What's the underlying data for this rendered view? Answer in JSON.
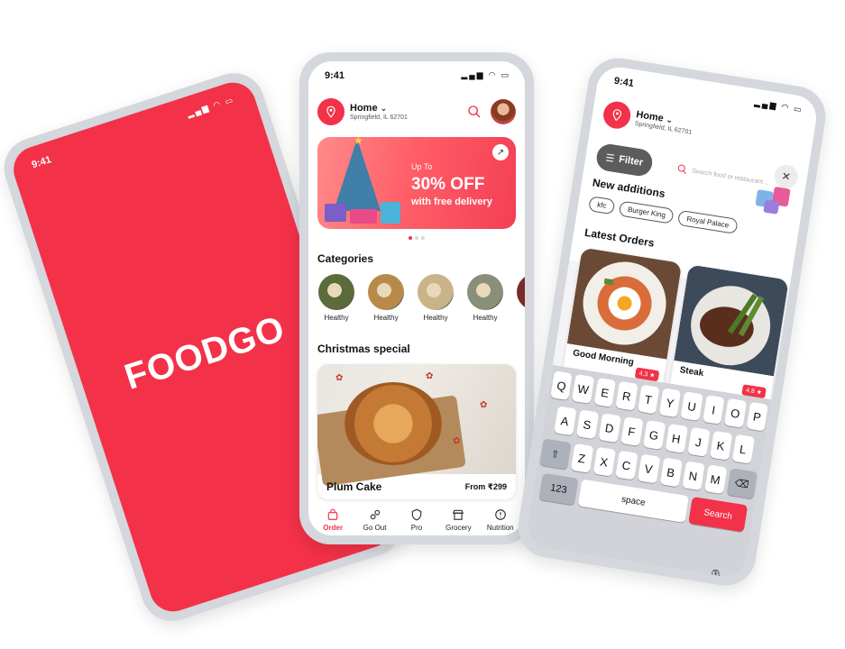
{
  "splash": {
    "time": "9:41",
    "brand": "FOODGO"
  },
  "home": {
    "time": "9:41",
    "location": {
      "title": "Home",
      "address": "Springfield, IL 62701"
    },
    "banner": {
      "line1": "Up To",
      "line2": "30% OFF",
      "line3": "with free delivery"
    },
    "categories_title": "Categories",
    "categories": [
      {
        "label": "Healthy",
        "color": "#5b6b3a"
      },
      {
        "label": "Healthy",
        "color": "#b88a4a"
      },
      {
        "label": "Healthy",
        "color": "#c9b48a"
      },
      {
        "label": "Healthy",
        "color": "#8a8f7a"
      },
      {
        "label": "Hea",
        "color": "#7a2a2a"
      }
    ],
    "special_title": "Christmas special",
    "special_card": {
      "name": "Plum Cake",
      "price": "From ₹299"
    },
    "tabs": [
      {
        "label": "Order",
        "icon": "bag-icon",
        "active": true
      },
      {
        "label": "Go Out",
        "icon": "go-out-icon",
        "active": false
      },
      {
        "label": "Pro",
        "icon": "pro-shield-icon",
        "active": false
      },
      {
        "label": "Grocery",
        "icon": "grocery-store-icon",
        "active": false
      },
      {
        "label": "Nutrition",
        "icon": "nutrition-icon",
        "active": false
      }
    ]
  },
  "search_screen": {
    "time": "9:41",
    "location": {
      "title": "Home",
      "address": "Springfield, IL 62701"
    },
    "filter_label": "Filter",
    "search_placeholder": "Search food or restaurant...",
    "new_additions_title": "New additions",
    "new_additions": [
      "kfc",
      "Burger King",
      "Royal Palace"
    ],
    "latest_orders_title": "Latest Orders",
    "orders": [
      {
        "name": "Good Morning",
        "rating": "4.3 ★"
      },
      {
        "name": "Steak",
        "rating": "4.8 ★"
      }
    ],
    "keyboard": {
      "row1": [
        "Q",
        "W",
        "E",
        "R",
        "T",
        "Y",
        "U",
        "I",
        "O",
        "P"
      ],
      "row2": [
        "A",
        "S",
        "D",
        "F",
        "G",
        "H",
        "J",
        "K",
        "L"
      ],
      "row3": [
        "Z",
        "X",
        "C",
        "V",
        "B",
        "N",
        "M"
      ],
      "space": "space",
      "search": "Search"
    }
  },
  "colors": {
    "brand_red": "#f33148"
  }
}
